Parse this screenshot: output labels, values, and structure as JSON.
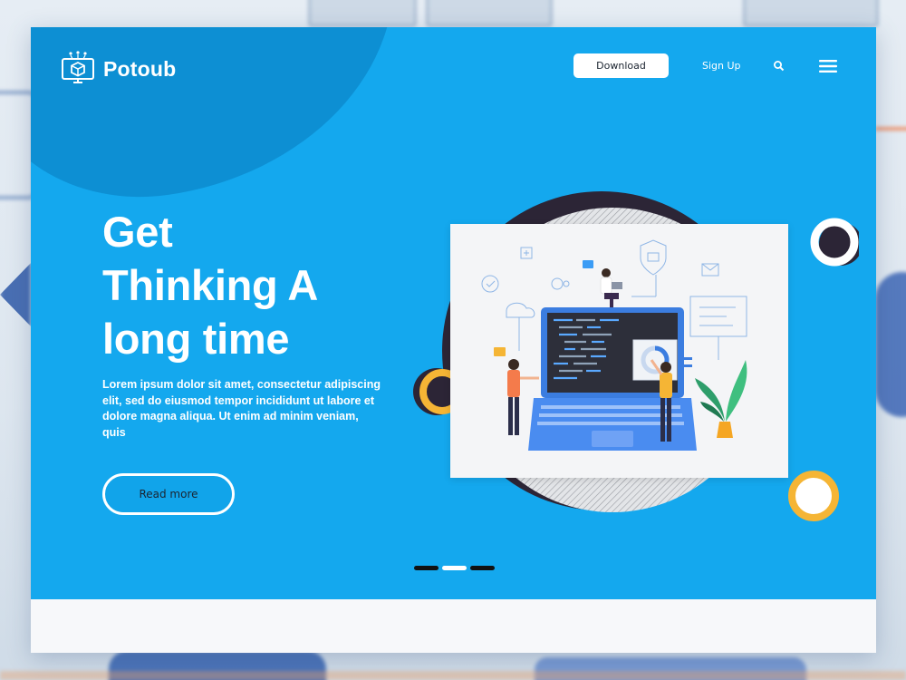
{
  "brand": {
    "name": "Potoub"
  },
  "nav": {
    "download_label": "Download",
    "signup_label": "Sign Up"
  },
  "hero": {
    "headline_lines": [
      "Get",
      "Thinking A",
      "long time"
    ],
    "description": "Lorem ipsum dolor sit amet, consectetur adipiscing elit, sed do eiusmod tempor incididunt ut labore et dolore magna aliqua. Ut enim ad minim veniam, quis",
    "read_more_label": "Read more"
  },
  "carousel": {
    "slide_count": 3,
    "active_index": 1
  },
  "colors": {
    "hero_bg": "#14a8ee",
    "hero_blob": "#0d8fd3",
    "accent_orange": "#f5b535",
    "dark": "#1b2430"
  },
  "icons": {
    "logo": "monitor-cube-icon",
    "search": "search-icon",
    "menu": "hamburger-menu-icon"
  }
}
